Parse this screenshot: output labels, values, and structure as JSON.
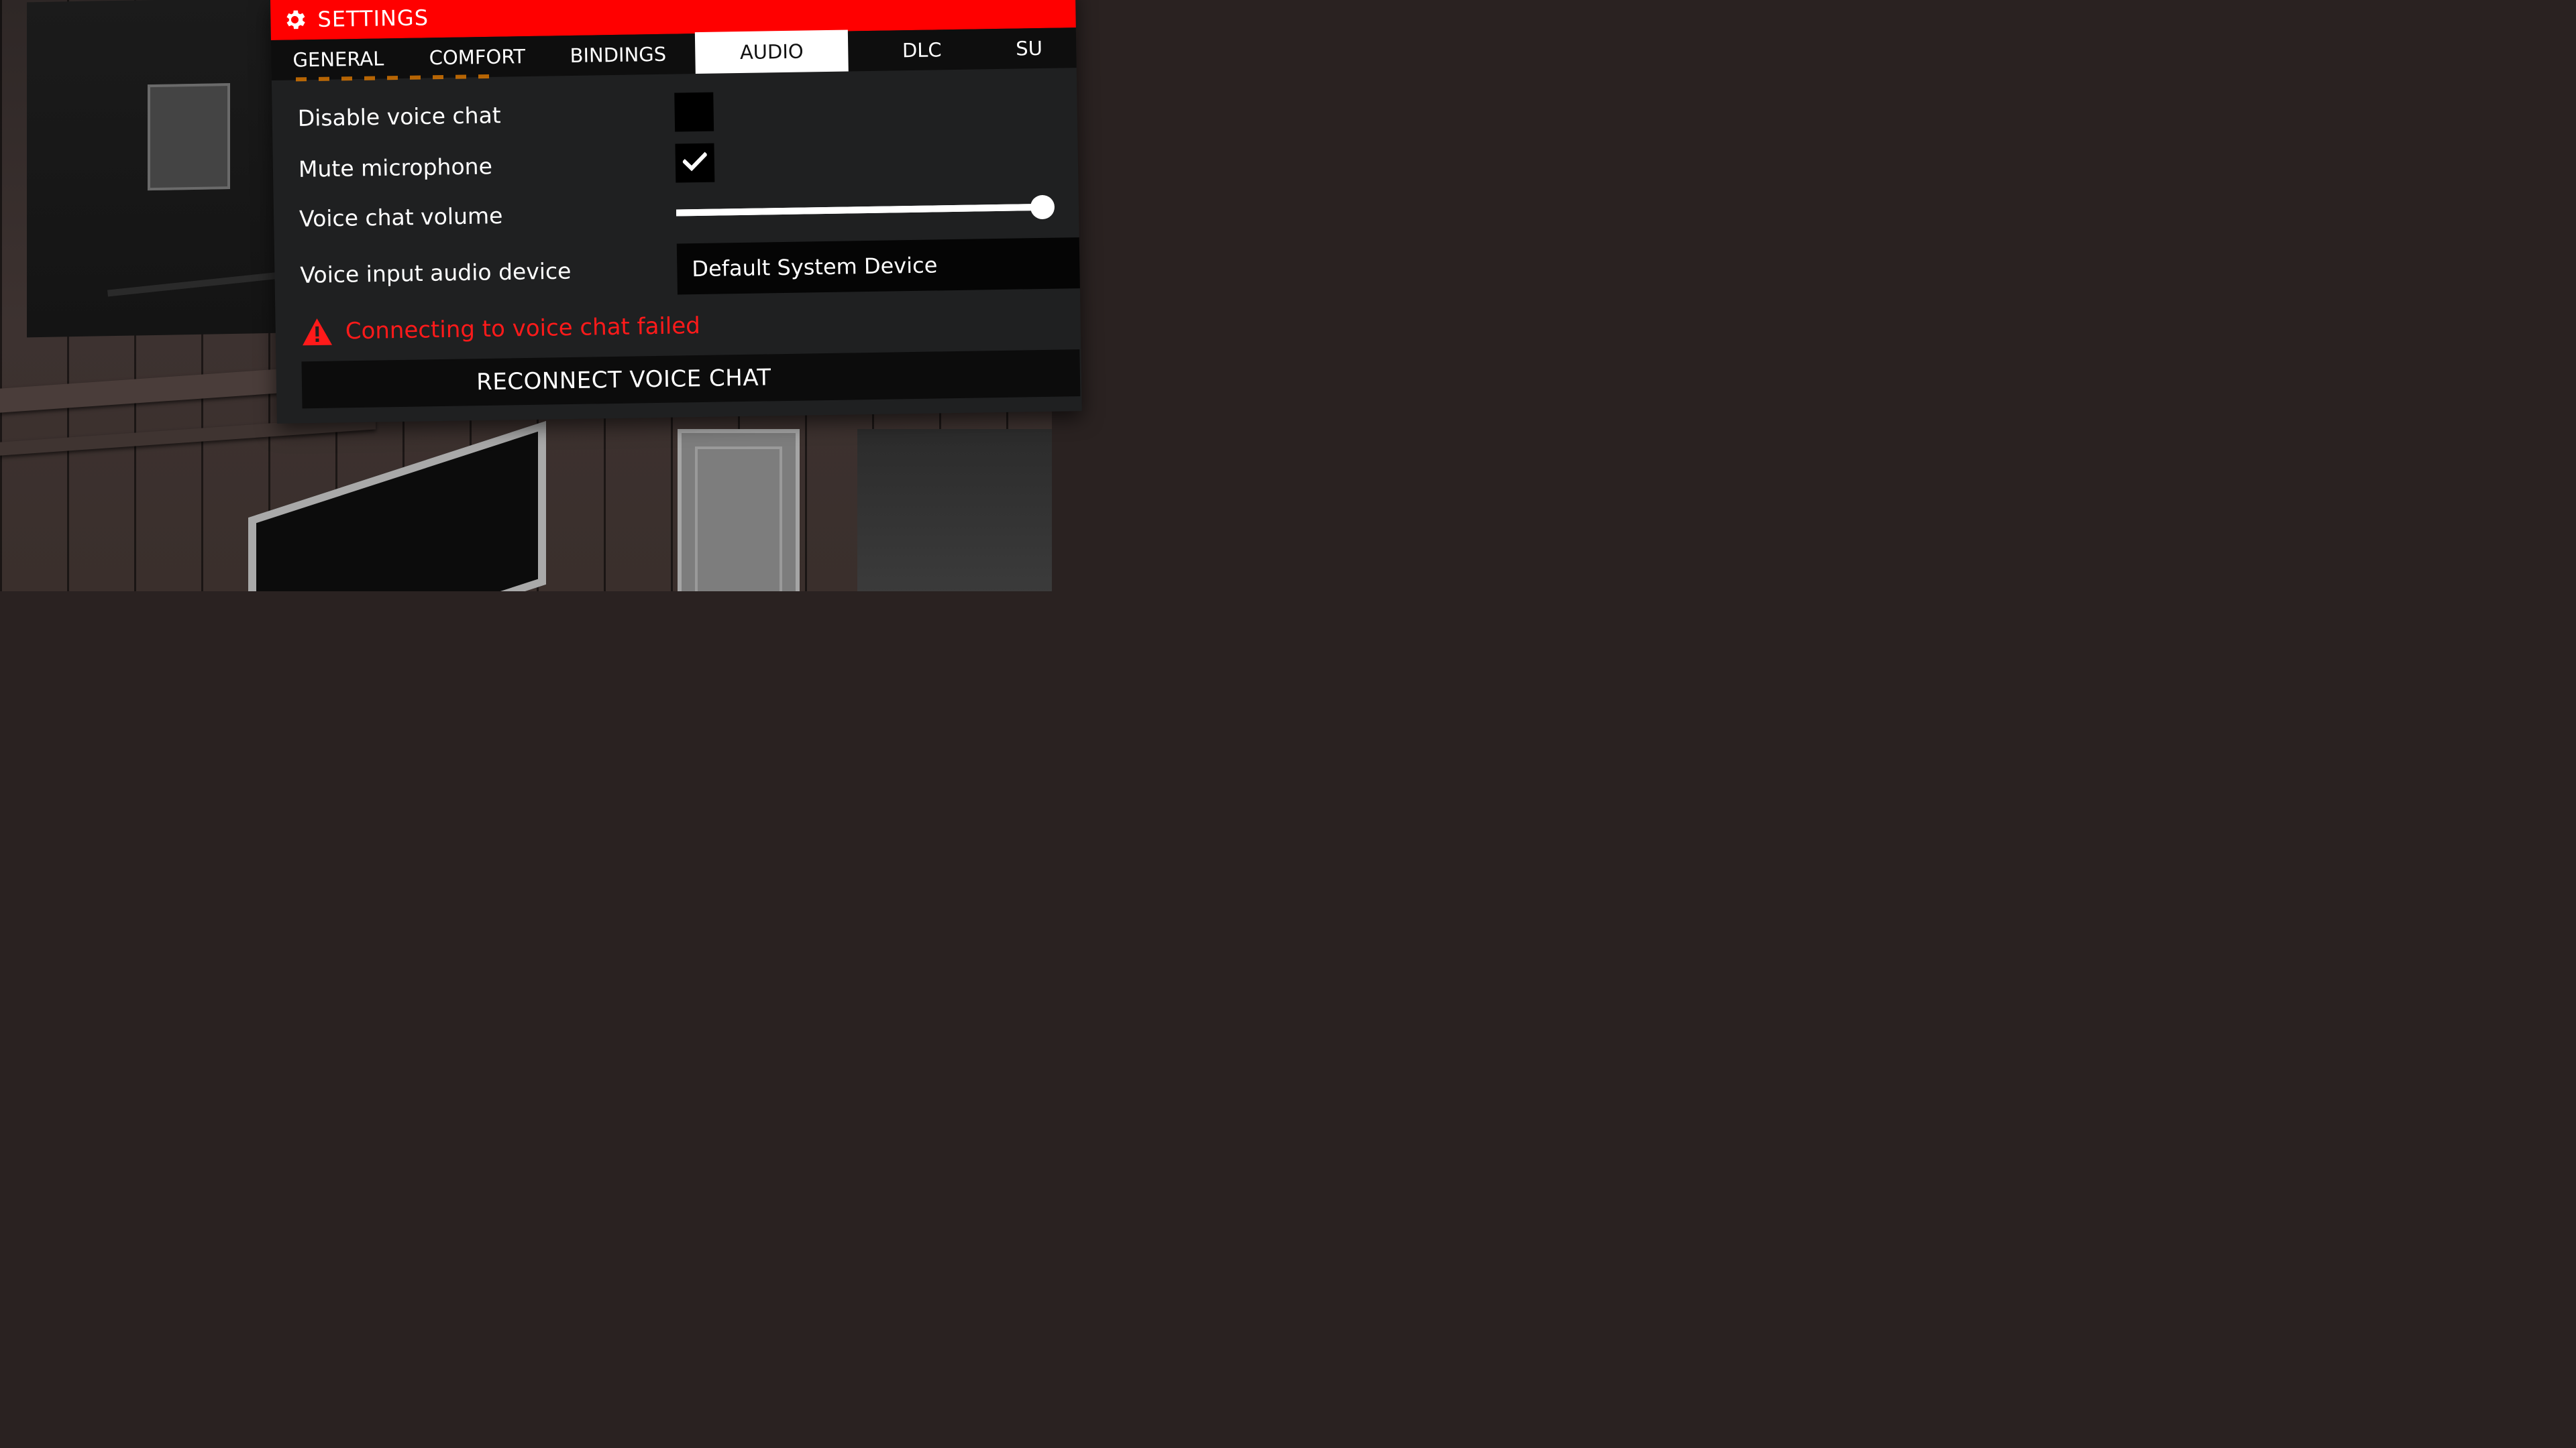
{
  "panel": {
    "title": "SETTINGS",
    "title_icon": "gear-icon",
    "accent_color": "#ff0000"
  },
  "tabs": [
    {
      "label": "GENERAL",
      "active": false
    },
    {
      "label": "COMFORT",
      "active": false
    },
    {
      "label": "BINDINGS",
      "active": false
    },
    {
      "label": "AUDIO",
      "active": true
    },
    {
      "label": "DLC",
      "active": false
    },
    {
      "label": "SU",
      "active": false
    }
  ],
  "audio": {
    "disable_voice_chat": {
      "label": "Disable voice chat",
      "checked": false
    },
    "mute_microphone": {
      "label": "Mute microphone",
      "checked": true,
      "icon": "checkmark-icon"
    },
    "voice_chat_volume": {
      "label": "Voice chat volume",
      "value": 1.0
    },
    "voice_input_device": {
      "label": "Voice input audio device",
      "selected": "Default System Device"
    },
    "error": {
      "icon": "warning-icon",
      "message": "Connecting to voice chat failed",
      "color": "#ff1a1a"
    },
    "reconnect_button": {
      "label": "RECONNECT VOICE CHAT"
    }
  }
}
